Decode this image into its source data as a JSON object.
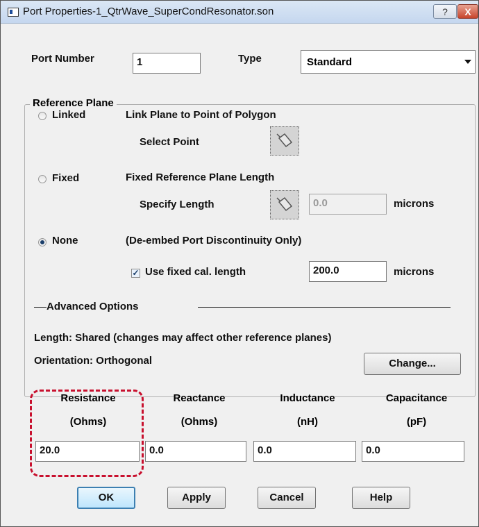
{
  "window": {
    "title": "Port Properties-1_QtrWave_SuperCondResonator.son",
    "help_label": "?",
    "close_label": "X"
  },
  "port": {
    "number_label": "Port Number",
    "number_value": "1",
    "type_label": "Type",
    "type_value": "Standard"
  },
  "reference_plane": {
    "group_label": "Reference Plane",
    "linked": {
      "label": "Linked",
      "description": "Link Plane to Point of Polygon",
      "select_label": "Select Point",
      "selected": false
    },
    "fixed": {
      "label": "Fixed",
      "description": "Fixed Reference Plane Length",
      "specify_label": "Specify Length",
      "length_value": "0.0",
      "units": "microns",
      "selected": false
    },
    "none": {
      "label": "None",
      "description": "(De-embed Port Discontinuity Only)",
      "use_fixed_label": "Use fixed cal. length",
      "use_fixed_checked": true,
      "cal_length_value": "200.0",
      "units": "microns",
      "selected": true
    }
  },
  "advanced": {
    "label": "Advanced Options",
    "length_text": "Length: Shared (changes may affect other reference planes)",
    "orientation_text": "Orientation: Orthogonal",
    "change_button": "Change..."
  },
  "params": {
    "resistance": {
      "label": "Resistance",
      "unit": "(Ohms)",
      "value": "20.0"
    },
    "reactance": {
      "label": "Reactance",
      "unit": "(Ohms)",
      "value": "0.0"
    },
    "inductance": {
      "label": "Inductance",
      "unit": "(nH)",
      "value": "0.0"
    },
    "capacitance": {
      "label": "Capacitance",
      "unit": "(pF)",
      "value": "0.0"
    }
  },
  "buttons": {
    "ok": "OK",
    "apply": "Apply",
    "cancel": "Cancel",
    "help": "Help"
  },
  "colors": {
    "highlight": "#c8102e",
    "default_button_border": "#3c7fb1"
  }
}
